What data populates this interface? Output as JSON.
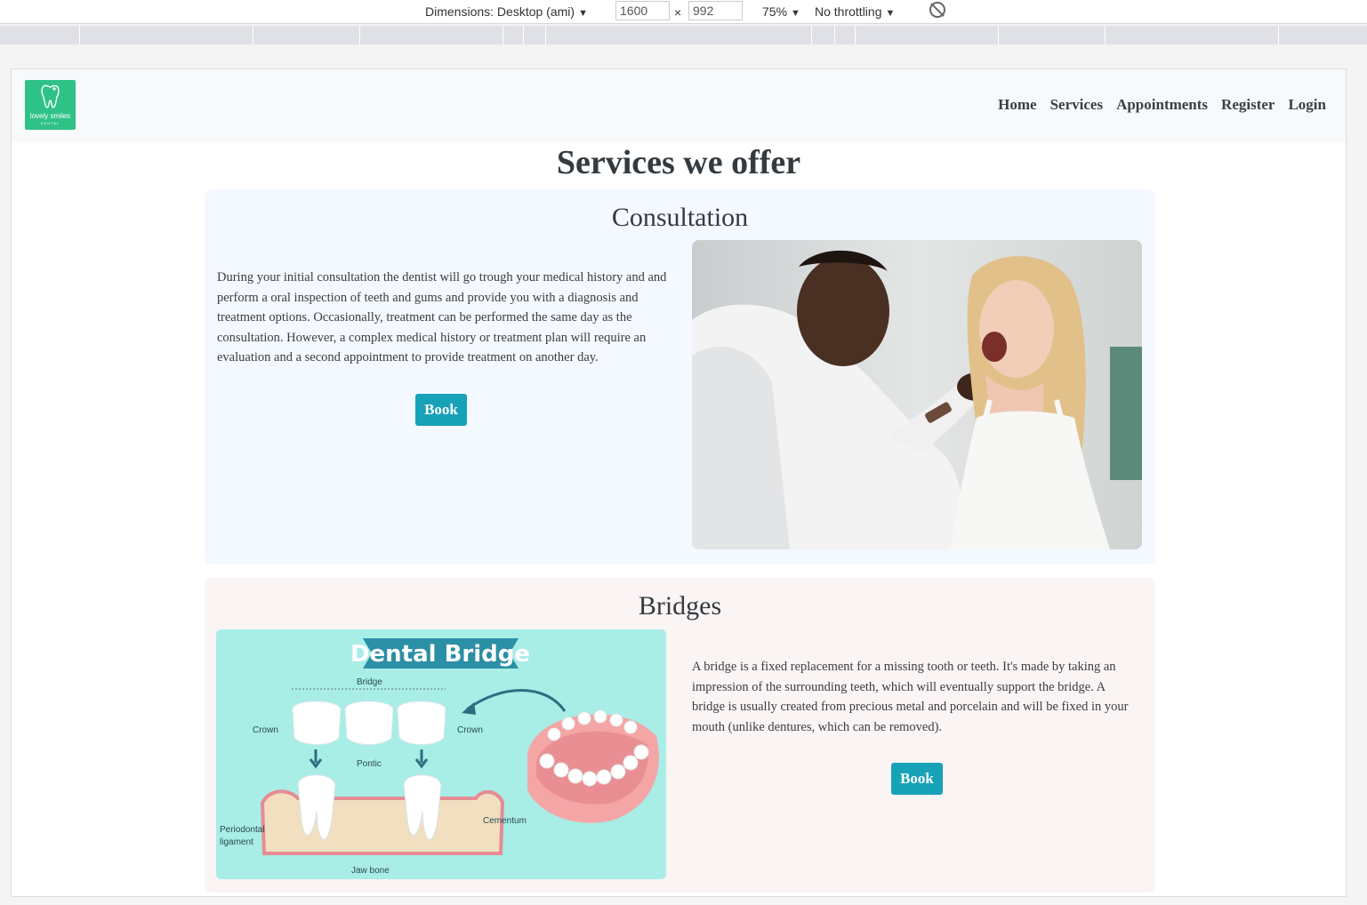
{
  "devtools": {
    "dimensions_label": "Dimensions: Desktop (ami)",
    "width_value": "1600",
    "times": "×",
    "height_value": "992",
    "zoom": "75%",
    "throttling": "No throttling"
  },
  "navbar": {
    "logo_text": "lovely smiles",
    "logo_subtext": "DENTAL",
    "links": [
      "Home",
      "Services",
      "Appointments",
      "Register",
      "Login"
    ]
  },
  "page_title": "Services we offer",
  "services": [
    {
      "title": "Consultation",
      "description": "During your initial consultation the dentist will go trough your medical history and and perform a oral inspection of teeth and gums and provide you with a diagnosis and treatment options. Occasionally, treatment can be performed the same day as the consultation. However, a complex medical history or treatment plan will require an evaluation and a second appointment to provide treatment on another day.",
      "button": "Book"
    },
    {
      "title": "Bridges",
      "description": "A bridge is a fixed replacement for a missing tooth or teeth. It's made by taking an impression of the surrounding teeth, which will eventually support the bridge. A bridge is usually created from precious metal and porcelain and will be fixed in your mouth (unlike dentures, which can be removed).",
      "button": "Book",
      "diagram": {
        "title": "Dental Bridge",
        "labels": {
          "bridge": "Bridge",
          "crown_left": "Crown",
          "crown_right": "Crown",
          "pontic": "Pontic",
          "cementum": "Cementum",
          "periodontal_1": "Periodontal",
          "periodontal_2": "ligament",
          "jaw_bone": "Jaw bone"
        }
      }
    }
  ],
  "colors": {
    "accent": "#17a2b8",
    "logo": "#2fc287",
    "card1_bg": "#f4f8ff",
    "card2_bg": "#fbf4f4"
  }
}
